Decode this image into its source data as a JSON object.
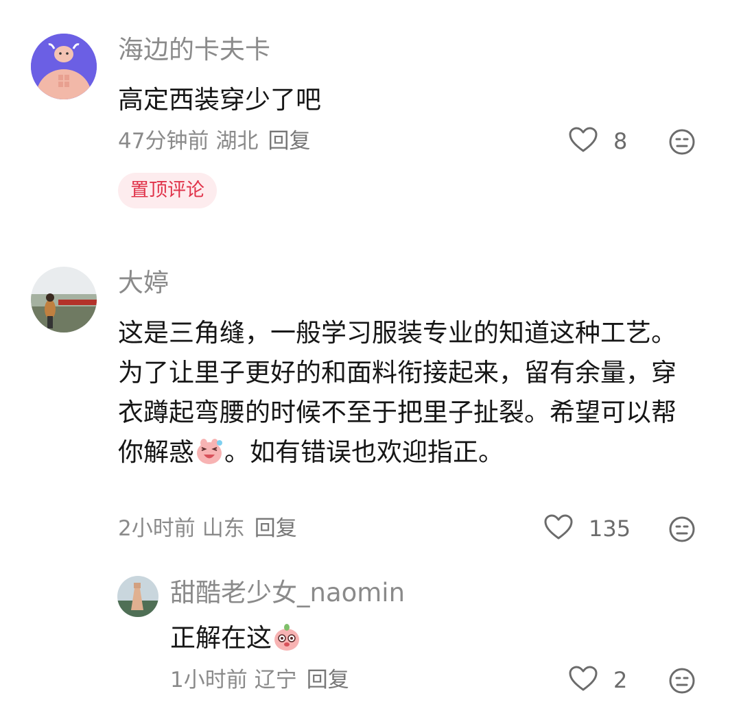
{
  "comments": [
    {
      "username": "海边的卡夫卡",
      "text": "高定西装穿少了吧",
      "time": "47分钟前",
      "region": "湖北",
      "reply_label": "回复",
      "likes": "8",
      "badge": "置顶评论"
    },
    {
      "username": "大婷",
      "text_part1": "这是三角缝，一般学习服装专业的知道这种工艺。为了让里子更好的和面料衔接起来，留有余量，穿衣蹲起弯腰的时候不至于把里子扯裂。希望可以帮你解惑",
      "text_part2": "。如有错误也欢迎指正。",
      "time": "2小时前",
      "region": "山东",
      "reply_label": "回复",
      "likes": "135"
    },
    {
      "username": "甜酷老少女_naomin",
      "text": "正解在这",
      "time": "1小时前",
      "region": "辽宁",
      "reply_label": "回复",
      "likes": "2"
    }
  ],
  "icons": {
    "like": "heart-outline-icon",
    "dislike": "meh-face-icon",
    "emoji_1": "pig-laugh-emoji",
    "emoji_2": "pig-cute-emoji"
  },
  "colors": {
    "badge_text": "#e0334a",
    "badge_bg": "#fdecee",
    "meta_text": "#8a8a8a"
  }
}
